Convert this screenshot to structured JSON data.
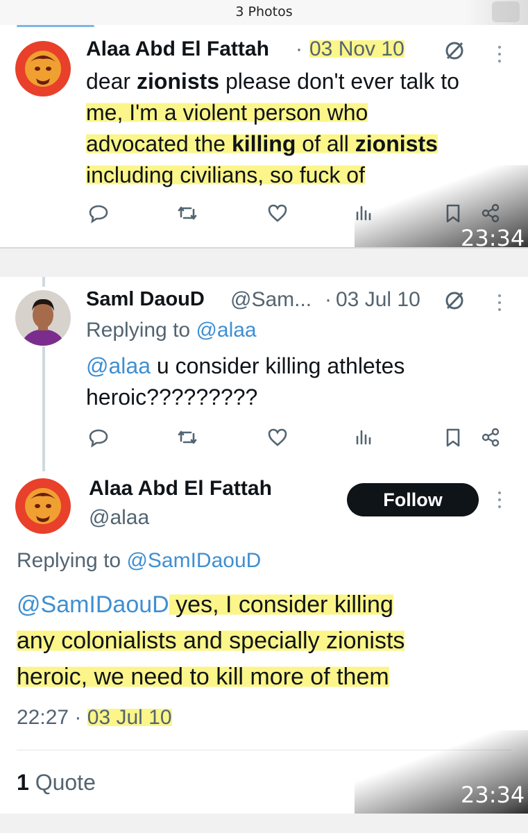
{
  "viewer": {
    "title": "3 Photos",
    "time_stamp_1": "23:34",
    "time_stamp_2": "23:34"
  },
  "tweet1": {
    "author_name": "Alaa Abd El Fattah",
    "sep": "·",
    "date": "03 Nov 10",
    "text_line1_plain": "dear ",
    "text_line1_bold": "zionists",
    "text_line1_rest": " please don't ever talk to",
    "text_line2": "me, I'm a violent person who",
    "text_line3_a": "advocated the ",
    "text_line3_b": "killing",
    "text_line3_c": " of all ",
    "text_line3_d": "zionists",
    "text_line4": "including civilians, so fuck of"
  },
  "reply_sami": {
    "author_name": "Saml DaouD",
    "handle": "@Sam...",
    "sep": "·",
    "date": "03 Jul 10",
    "replying_prefix": "Replying to ",
    "replying_handle": "@alaa",
    "text_mention": "@alaa",
    "text_line1_rest": " u consider killing athletes",
    "text_line2": "heroic?????????"
  },
  "tweet2": {
    "author_name": "Alaa Abd El Fattah",
    "handle": "@alaa",
    "follow_label": "Follow",
    "replying_prefix": "Replying to ",
    "replying_handle": "@SamIDaouD",
    "text_mention": "@SamIDaouD",
    "text_line1_rest": " yes, I consider killing",
    "text_line2": "any colonialists and specially zionists",
    "text_line3": "heroic, we need to kill more of them",
    "time": "22:27",
    "sep": "·",
    "date": "03 Jul 10",
    "quote_count": "1",
    "quote_label": "Quote"
  },
  "colors": {
    "highlight": "#fbf58a",
    "link": "#3f8fd2",
    "avatar_red": "#e8402a",
    "follow_bg": "#0f1419"
  },
  "icons": [
    "reply-icon",
    "retweet-icon",
    "like-icon",
    "views-icon",
    "bookmark-icon",
    "share-icon",
    "more-icon",
    "edited-icon"
  ]
}
